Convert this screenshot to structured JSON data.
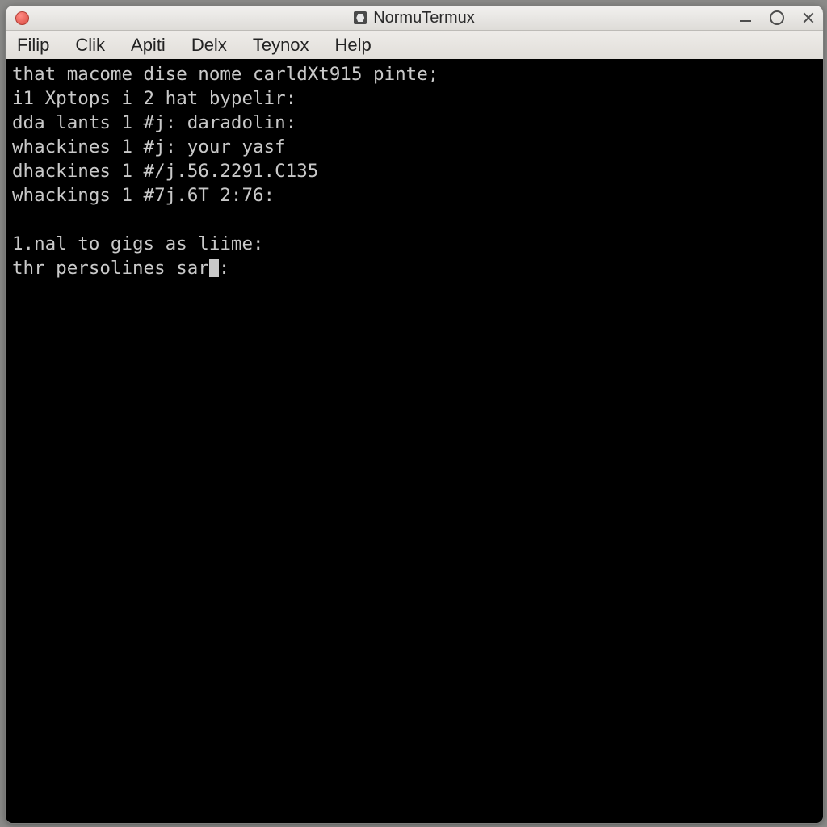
{
  "window": {
    "title": "NormuTermux"
  },
  "menu": {
    "items": [
      "Filip",
      "Clik",
      "Apiti",
      "Delx",
      "Teynox",
      "Help"
    ]
  },
  "terminal": {
    "lines": [
      "that macome dise nome carldXt915 pinte;",
      "i1 Xptops i 2 hat bypelir:",
      "dda lants 1 #j: daradolin:",
      "whackines 1 #j: your yasf",
      "dhackines 1 #/j.56.2291.C135",
      "whackings 1 #7j.6T 2:76:",
      "",
      "1.nal to gigs as liime:",
      "thr persolines sar"
    ],
    "trailing_after_cursor": ":"
  }
}
